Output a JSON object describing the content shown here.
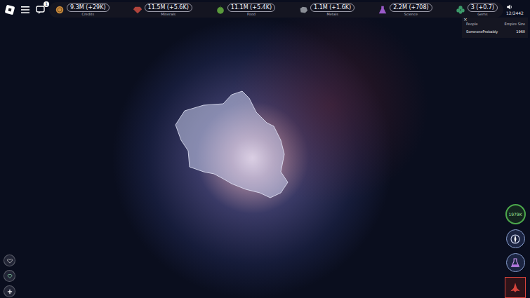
{
  "topbar": {
    "chat_badge": "1",
    "resources": [
      {
        "value": "9.3M (+29K)",
        "label": "Credits",
        "kind": "coin",
        "color": "#c98a3c"
      },
      {
        "value": "11.5M (+5.6K)",
        "label": "Minerals",
        "kind": "gem",
        "color": "#b0443c"
      },
      {
        "value": "11.1M (+5.4K)",
        "label": "Food",
        "kind": "food",
        "color": "#5a9a3c"
      },
      {
        "value": "1.1M (+1.6K)",
        "label": "Metals",
        "kind": "ore",
        "color": "#8a8e96"
      },
      {
        "value": "2.2M (+708)",
        "label": "Science",
        "kind": "flask",
        "color": "#9a5ac8"
      },
      {
        "value": "3 (+0.7)",
        "label": "Gems",
        "kind": "clover",
        "color": "#3c9a6a"
      }
    ],
    "counter": "12/2442"
  },
  "leaderboard": {
    "close": "×",
    "columns": [
      "People",
      "Empire Size"
    ],
    "rows": [
      {
        "name": "SomeoneProbably",
        "value": "1960"
      }
    ]
  },
  "left_buttons": [
    {
      "kind": "heart"
    },
    {
      "kind": "gem"
    },
    {
      "kind": "plus"
    }
  ],
  "right_buttons": [
    {
      "kind": "counter",
      "label": "1979K"
    },
    {
      "kind": "compass",
      "label": ""
    },
    {
      "kind": "flask",
      "label": ""
    },
    {
      "kind": "ship",
      "label": ""
    }
  ]
}
